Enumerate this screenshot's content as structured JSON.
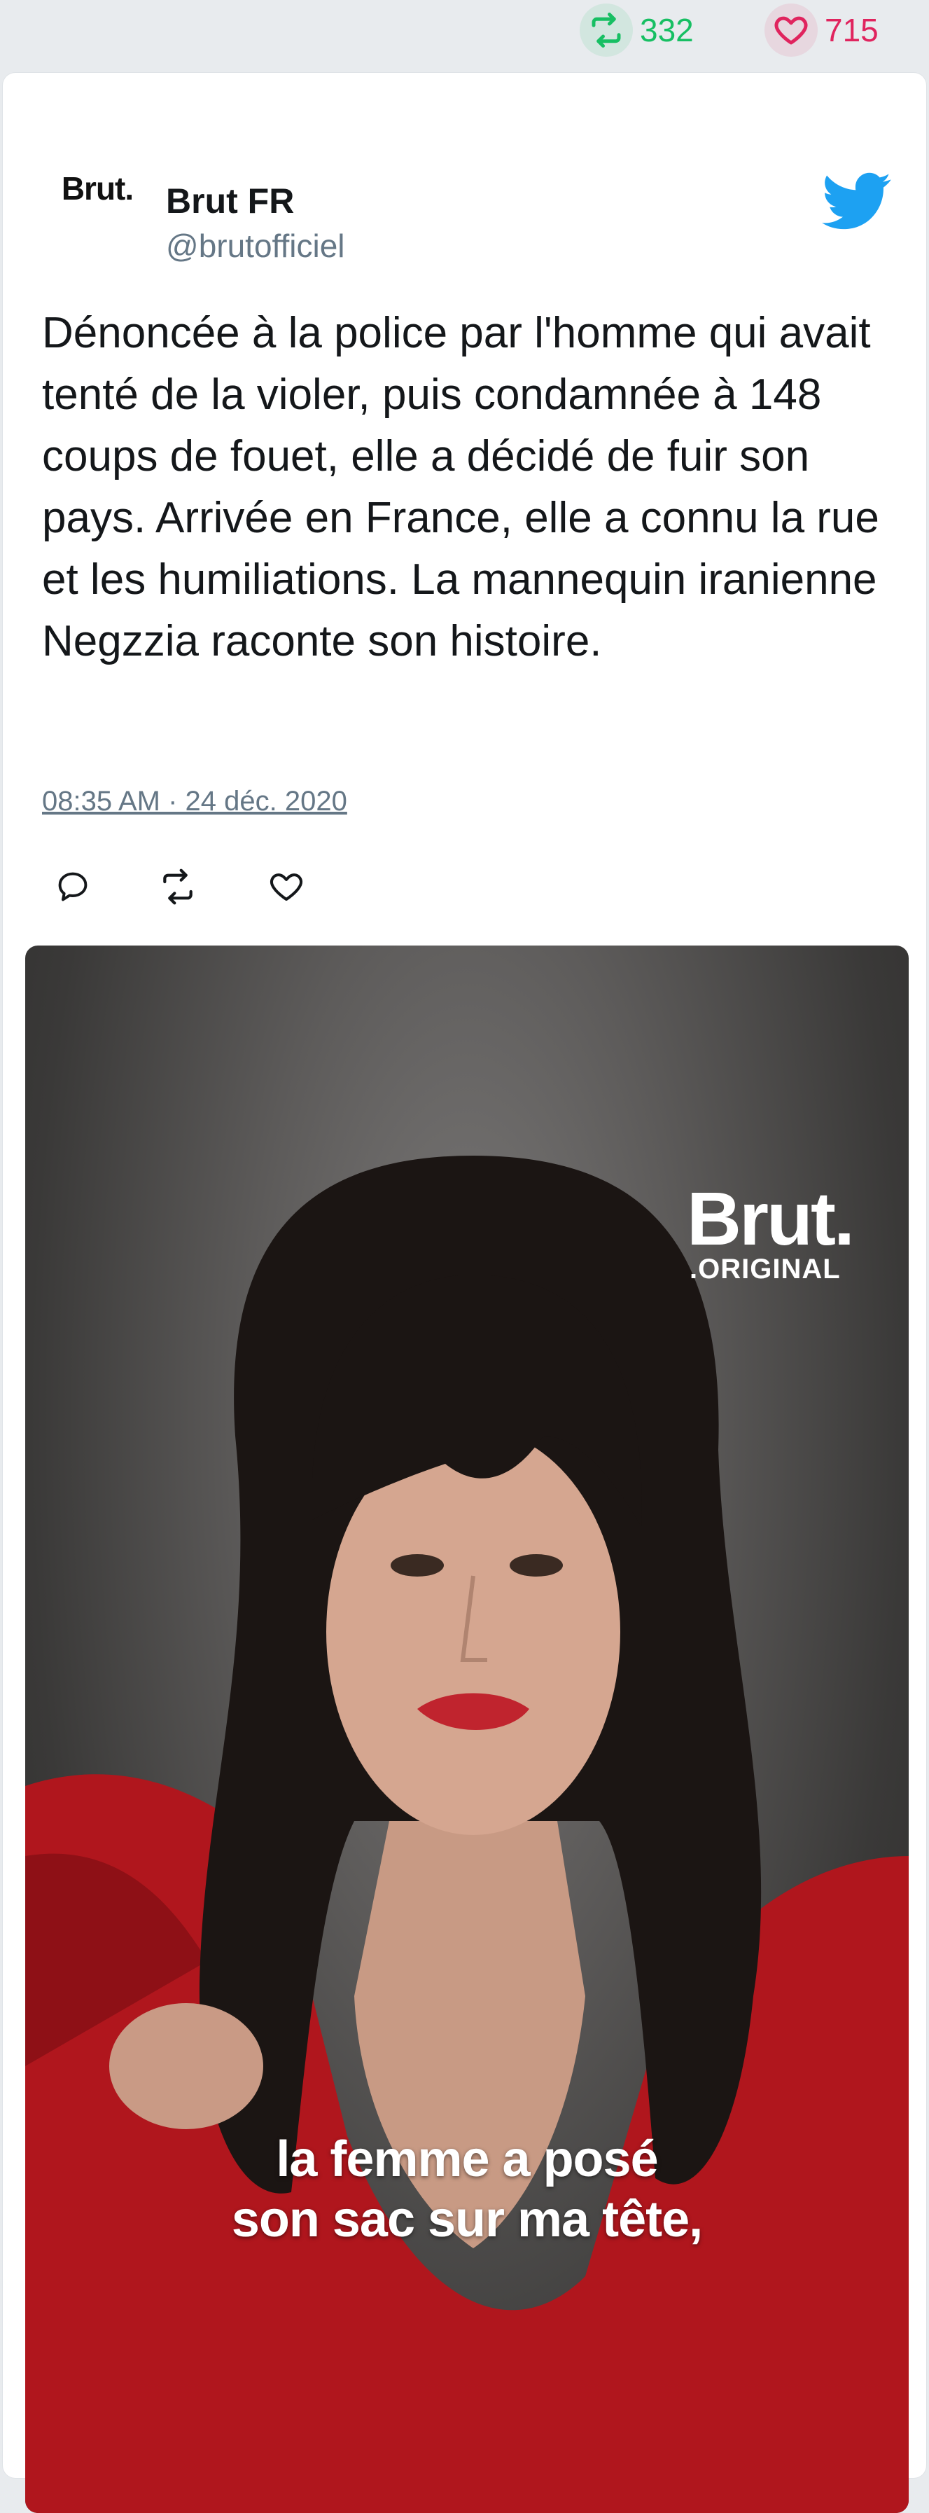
{
  "stats": {
    "retweets": "332",
    "likes": "715",
    "retweet_color": "#17bf63",
    "like_color": "#e0245e"
  },
  "author": {
    "avatar_text": "Brut.",
    "name": "Brut FR",
    "handle": "@brutofficiel"
  },
  "tweet": {
    "text": "Dénoncée à la police par l'homme qui avait tenté de la violer, puis condamnée à 148 coups de fouet, elle a décidé de fuir son pays. Arrivée en France, elle a connu la rue et les humiliations. La mannequin iranienne Negzzia raconte son histoire.",
    "timestamp": "08:35 AM · 24 déc. 2020"
  },
  "icons": {
    "brand": "twitter-bird-icon",
    "reply": "reply-icon",
    "retweet": "retweet-icon",
    "like": "heart-icon",
    "brand_color": "#1da1f2"
  },
  "media": {
    "logo_word": "Brut.",
    "logo_sub": ".ORIGINAL",
    "caption_line1": "la femme a posé",
    "caption_line2": "son sac sur ma tête,"
  }
}
